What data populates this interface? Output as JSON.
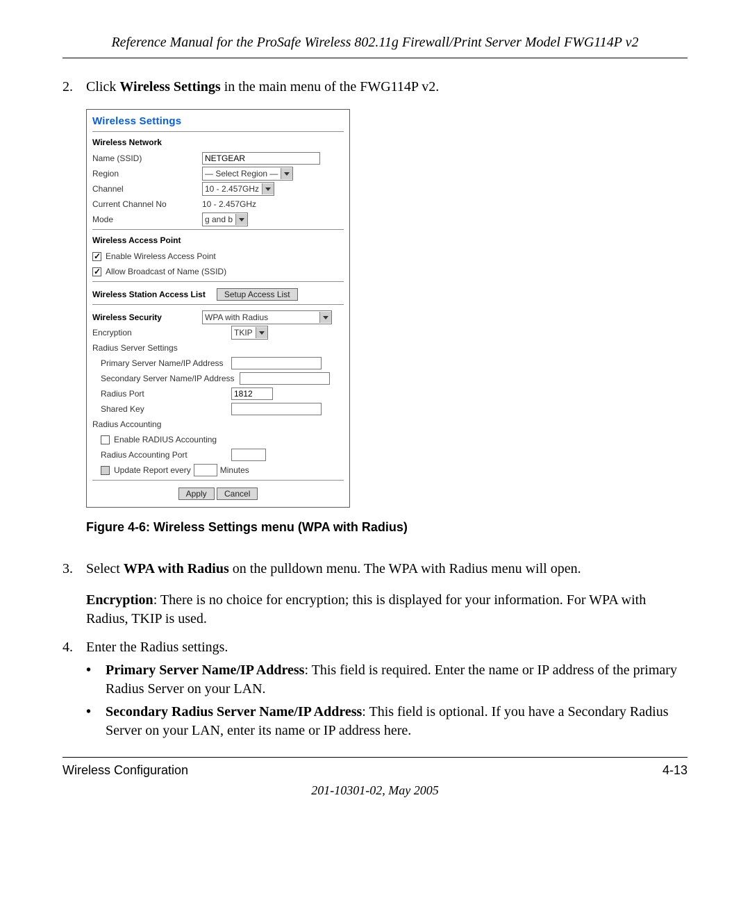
{
  "header": {
    "title": "Reference Manual for the ProSafe Wireless 802.11g  Firewall/Print Server Model FWG114P v2"
  },
  "steps": {
    "s2": {
      "num": "2.",
      "pre": "Click ",
      "bold": "Wireless Settings",
      "post": " in the main menu of the FWG114P v2."
    },
    "s3": {
      "num": "3.",
      "pre": "Select ",
      "bold": "WPA with Radius",
      "post": " on the pulldown menu. The WPA with Radius menu will open.",
      "para_bold": "Encryption",
      "para_rest": ": There is no choice for encryption; this is displayed for your information. For WPA with Radius, TKIP is used."
    },
    "s4": {
      "num": "4.",
      "text": "Enter the Radius settings.",
      "b1": {
        "bold": "Primary Server Name/IP Address",
        "rest": ": This field is required. Enter the name or IP address of the primary Radius Server on your LAN."
      },
      "b2": {
        "bold": "Secondary Radius Server Name/IP Address",
        "rest": ": This field is optional. If you have a Secondary Radius Server on your LAN, enter its name or IP address here."
      }
    }
  },
  "panel": {
    "title": "Wireless Settings",
    "net": {
      "heading": "Wireless Network",
      "ssid_label": "Name (SSID)",
      "ssid_value": "NETGEAR",
      "region_label": "Region",
      "region_value": "— Select Region —",
      "channel_label": "Channel",
      "channel_value": "10 - 2.457GHz",
      "cur_ch_label": "Current Channel No",
      "cur_ch_value": "10 - 2.457GHz",
      "mode_label": "Mode",
      "mode_value": "g and b"
    },
    "ap": {
      "heading": "Wireless Access Point",
      "enable_label": "Enable Wireless Access Point",
      "broadcast_label": "Allow Broadcast of Name (SSID)"
    },
    "acl": {
      "heading": "Wireless Station Access List",
      "button": "Setup Access List"
    },
    "sec": {
      "heading": "Wireless Security",
      "value": "WPA with Radius",
      "enc_label": "Encryption",
      "enc_value": "TKIP",
      "rss_label": "Radius Server Settings",
      "primary_label": "Primary Server Name/IP Address",
      "secondary_label": "Secondary Server Name/IP Address",
      "port_label": "Radius Port",
      "port_value": "1812",
      "key_label": "Shared Key",
      "acct_label": "Radius Accounting",
      "enable_acct_label": "Enable RADIUS Accounting",
      "acct_port_label": "Radius Accounting Port",
      "update_label": "Update Report every",
      "minutes_label": "Minutes"
    },
    "buttons": {
      "apply": "Apply",
      "cancel": "Cancel"
    }
  },
  "figure": {
    "caption": "Figure 4-6:  Wireless Settings menu (WPA with Radius)"
  },
  "footer": {
    "left": "Wireless Configuration",
    "right": "4-13",
    "center": "201-10301-02, May 2005"
  }
}
